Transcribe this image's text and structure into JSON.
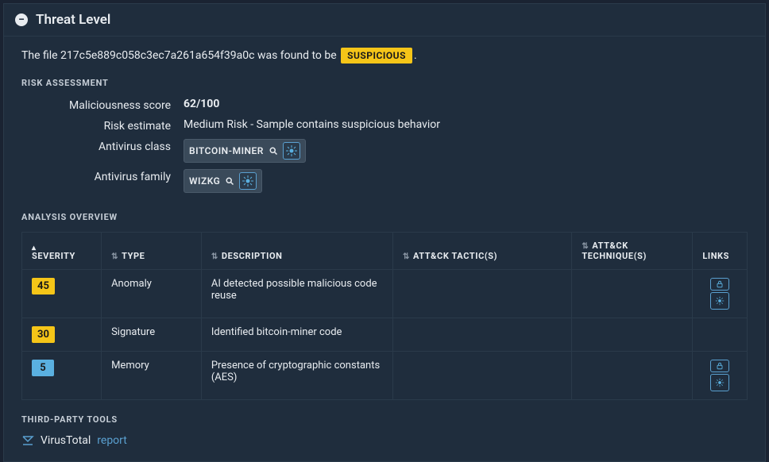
{
  "panel": {
    "title": "Threat Level"
  },
  "summary": {
    "prefix": "The file ",
    "hash": "217c5e889c058c3ec7a261a654f39a0c",
    "middle": " was found to be ",
    "verdict": "SUSPICIOUS",
    "suffix": "."
  },
  "risk": {
    "section_label": "RISK ASSESSMENT",
    "rows": {
      "score_label": "Maliciousness score",
      "score_value": "62/100",
      "estimate_label": "Risk estimate",
      "estimate_value": "Medium Risk - Sample contains suspicious behavior",
      "avclass_label": "Antivirus class",
      "avclass_value": "BITCOIN-MINER",
      "avfamily_label": "Antivirus family",
      "avfamily_value": "WIZKG"
    }
  },
  "overview": {
    "section_label": "ANALYSIS OVERVIEW",
    "headers": {
      "severity": "SEVERITY",
      "type": "TYPE",
      "description": "DESCRIPTION",
      "tactics": "ATT&CK TACTIC(S)",
      "techniques": "ATT&CK TECHNIQUE(S)",
      "links": "LINKS"
    },
    "rows": [
      {
        "severity": "45",
        "sev_color": "yellow",
        "type": "Anomaly",
        "description": "AI detected possible malicious code reuse",
        "tactics": "",
        "techniques": "",
        "has_links": true
      },
      {
        "severity": "30",
        "sev_color": "yellow",
        "type": "Signature",
        "description": "Identified bitcoin-miner code",
        "tactics": "",
        "techniques": "",
        "has_links": false
      },
      {
        "severity": "5",
        "sev_color": "blue",
        "type": "Memory",
        "description": "Presence of cryptographic constants (AES)",
        "tactics": "",
        "techniques": "",
        "has_links": true
      }
    ]
  },
  "third_party": {
    "section_label": "THIRD-PARTY TOOLS",
    "tool": "VirusTotal",
    "link_text": "report"
  }
}
